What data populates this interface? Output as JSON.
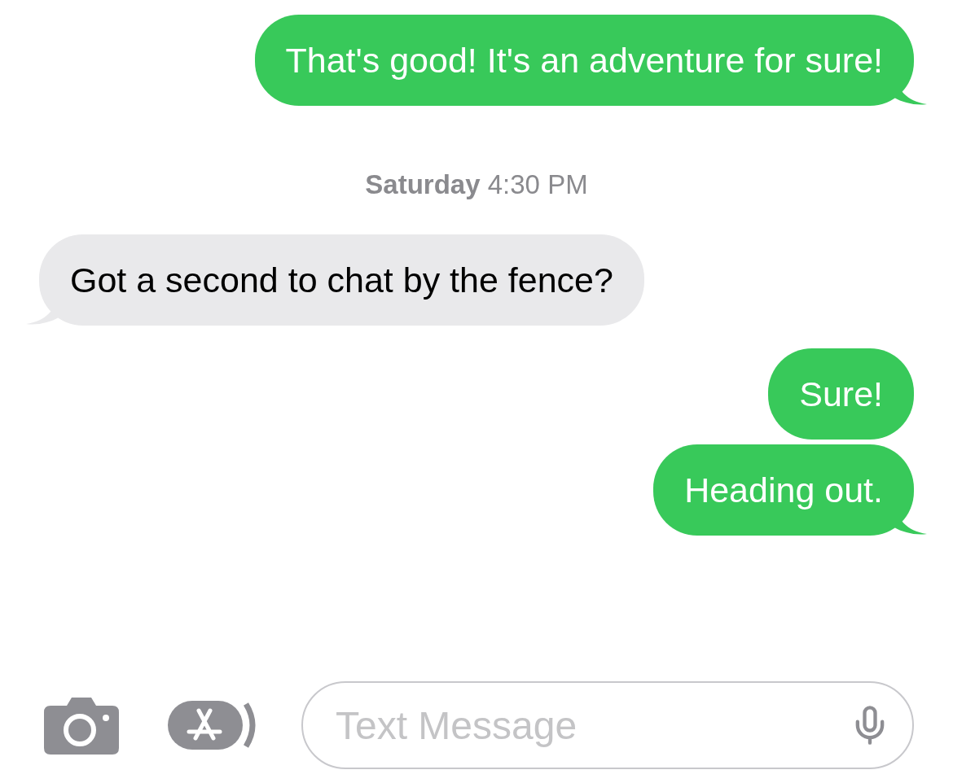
{
  "messages": [
    {
      "kind": "outgoing",
      "text": "That's good! It's an adventure for sure!",
      "tail": true
    },
    {
      "kind": "timestamp",
      "text": "**Saturday** 4:30 PM"
    },
    {
      "kind": "incoming",
      "text": "Got a second to chat by the fence?",
      "tail": true
    },
    {
      "kind": "outgoing",
      "text": "Sure!",
      "tail": false
    },
    {
      "kind": "outgoing",
      "text": "Heading out.",
      "tail": true
    }
  ],
  "composer": {
    "placeholder": "Text Message"
  }
}
